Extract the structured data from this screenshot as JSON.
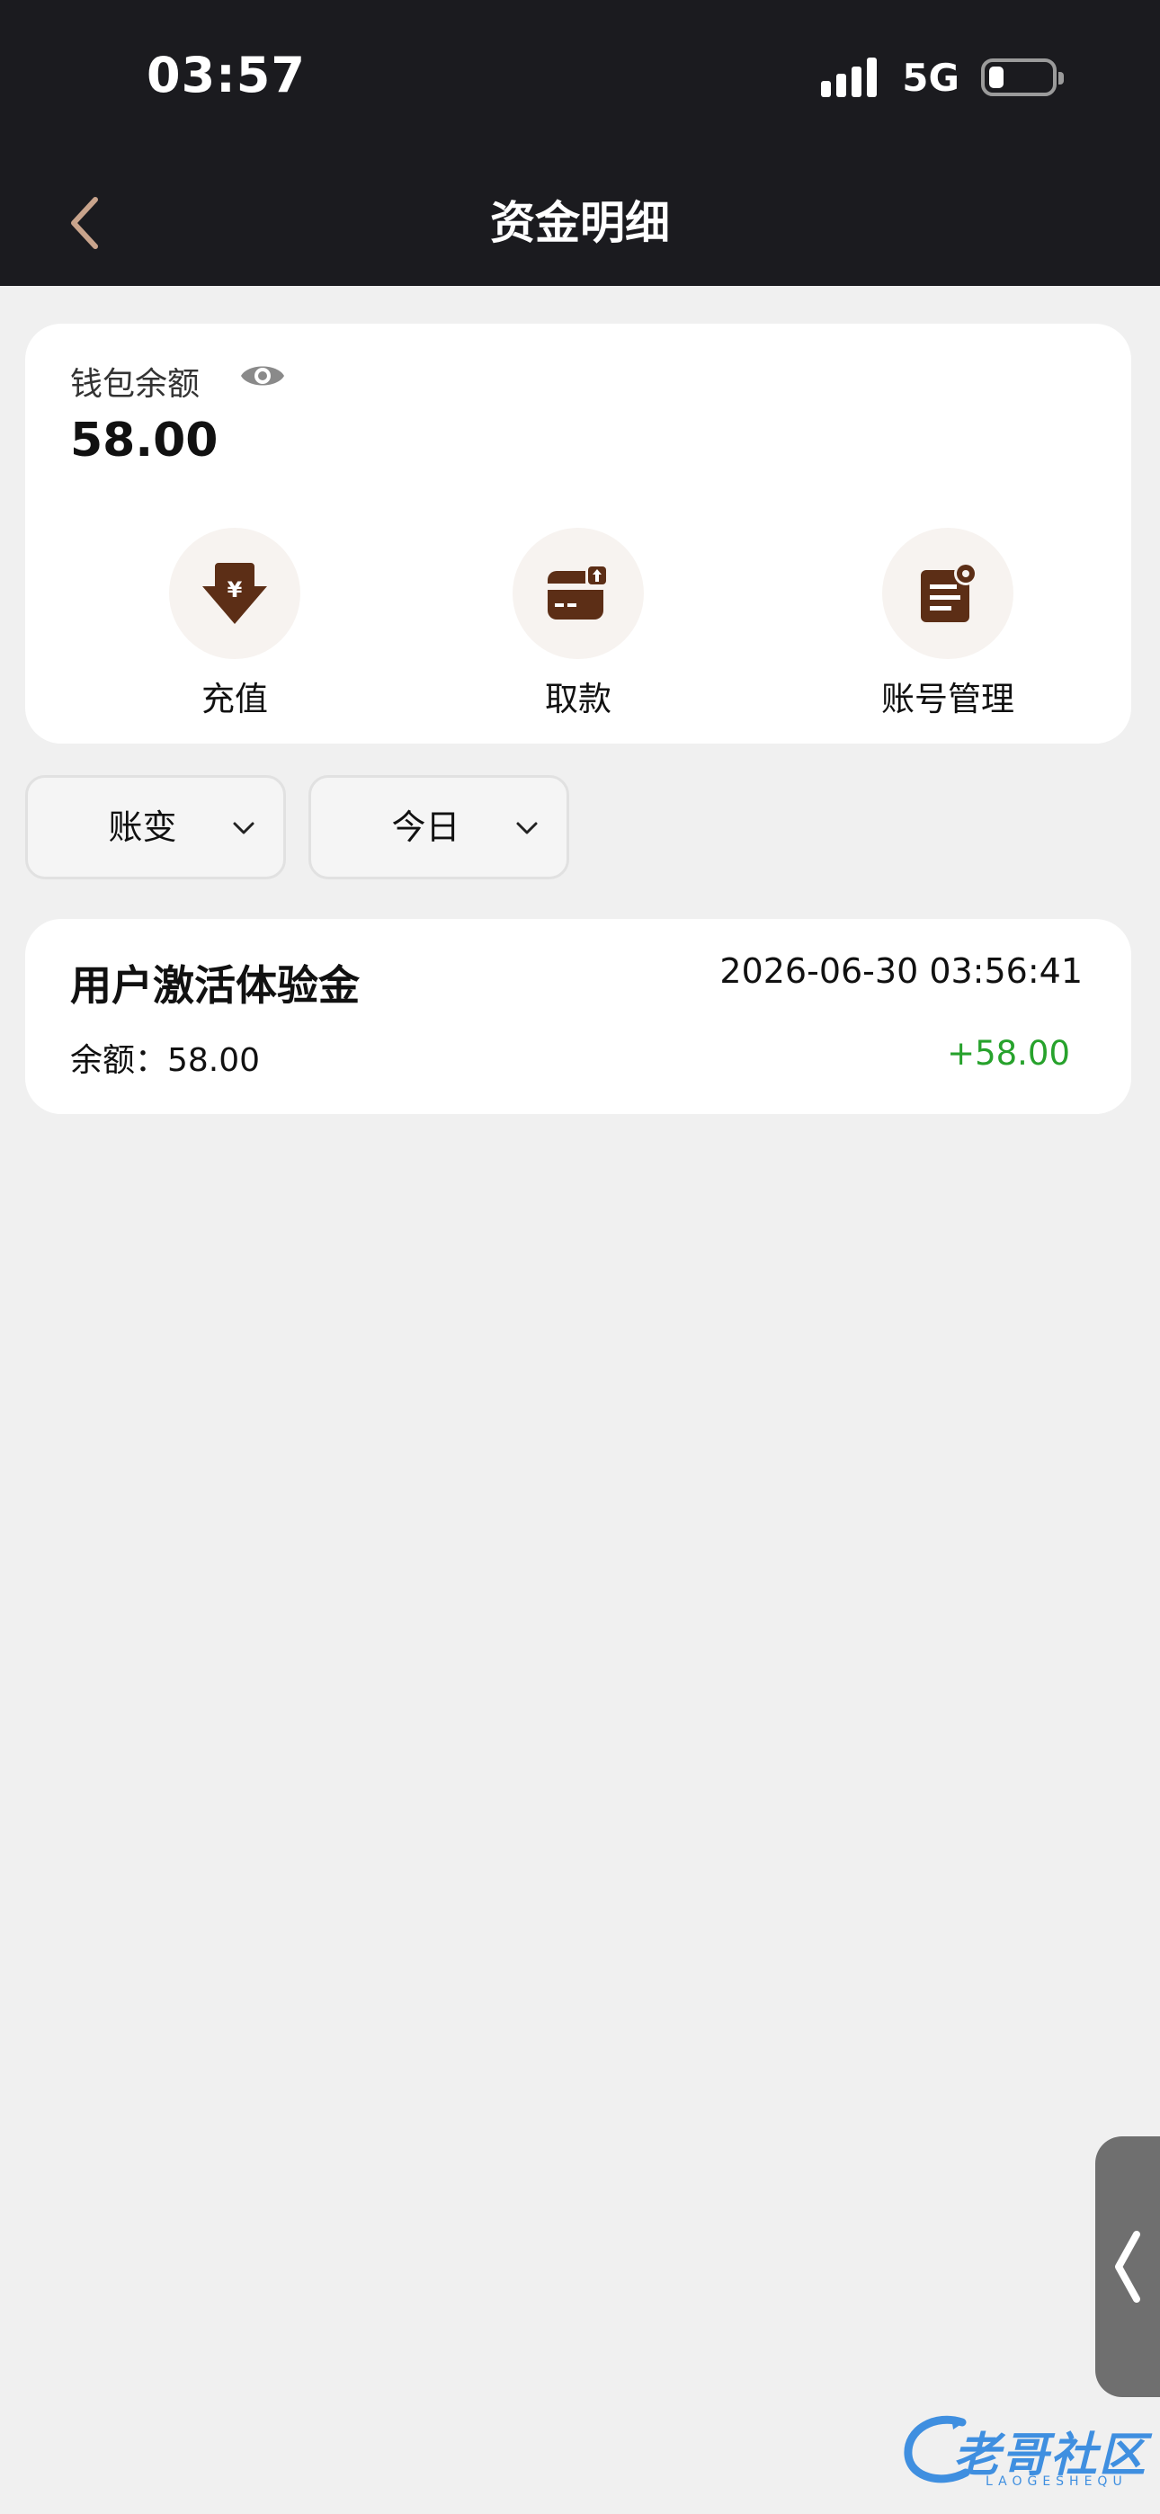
{
  "status_bar": {
    "time": "03:57",
    "network": "5G"
  },
  "header": {
    "title": "资金明细"
  },
  "wallet": {
    "label": "钱包余额",
    "amount": "58.00",
    "actions": [
      {
        "label": "充值",
        "icon": "deposit-icon"
      },
      {
        "label": "取款",
        "icon": "withdraw-card-icon"
      },
      {
        "label": "账号管理",
        "icon": "account-settings-icon"
      }
    ]
  },
  "filters": [
    {
      "label": "账变"
    },
    {
      "label": "今日"
    }
  ],
  "transactions": [
    {
      "title": "用户激活体验金",
      "time": "2026-06-30 03:56:41",
      "balance": "余额：58.00",
      "amount": "+58.00"
    }
  ],
  "watermark": {
    "text": "老哥社区",
    "subtext": "LAOGESHEQU"
  },
  "colors": {
    "header_bg": "#1b1b1f",
    "icon_brown": "#5c2e16",
    "positive_green": "#27a22c",
    "back_arrow": "#c9a48c"
  }
}
